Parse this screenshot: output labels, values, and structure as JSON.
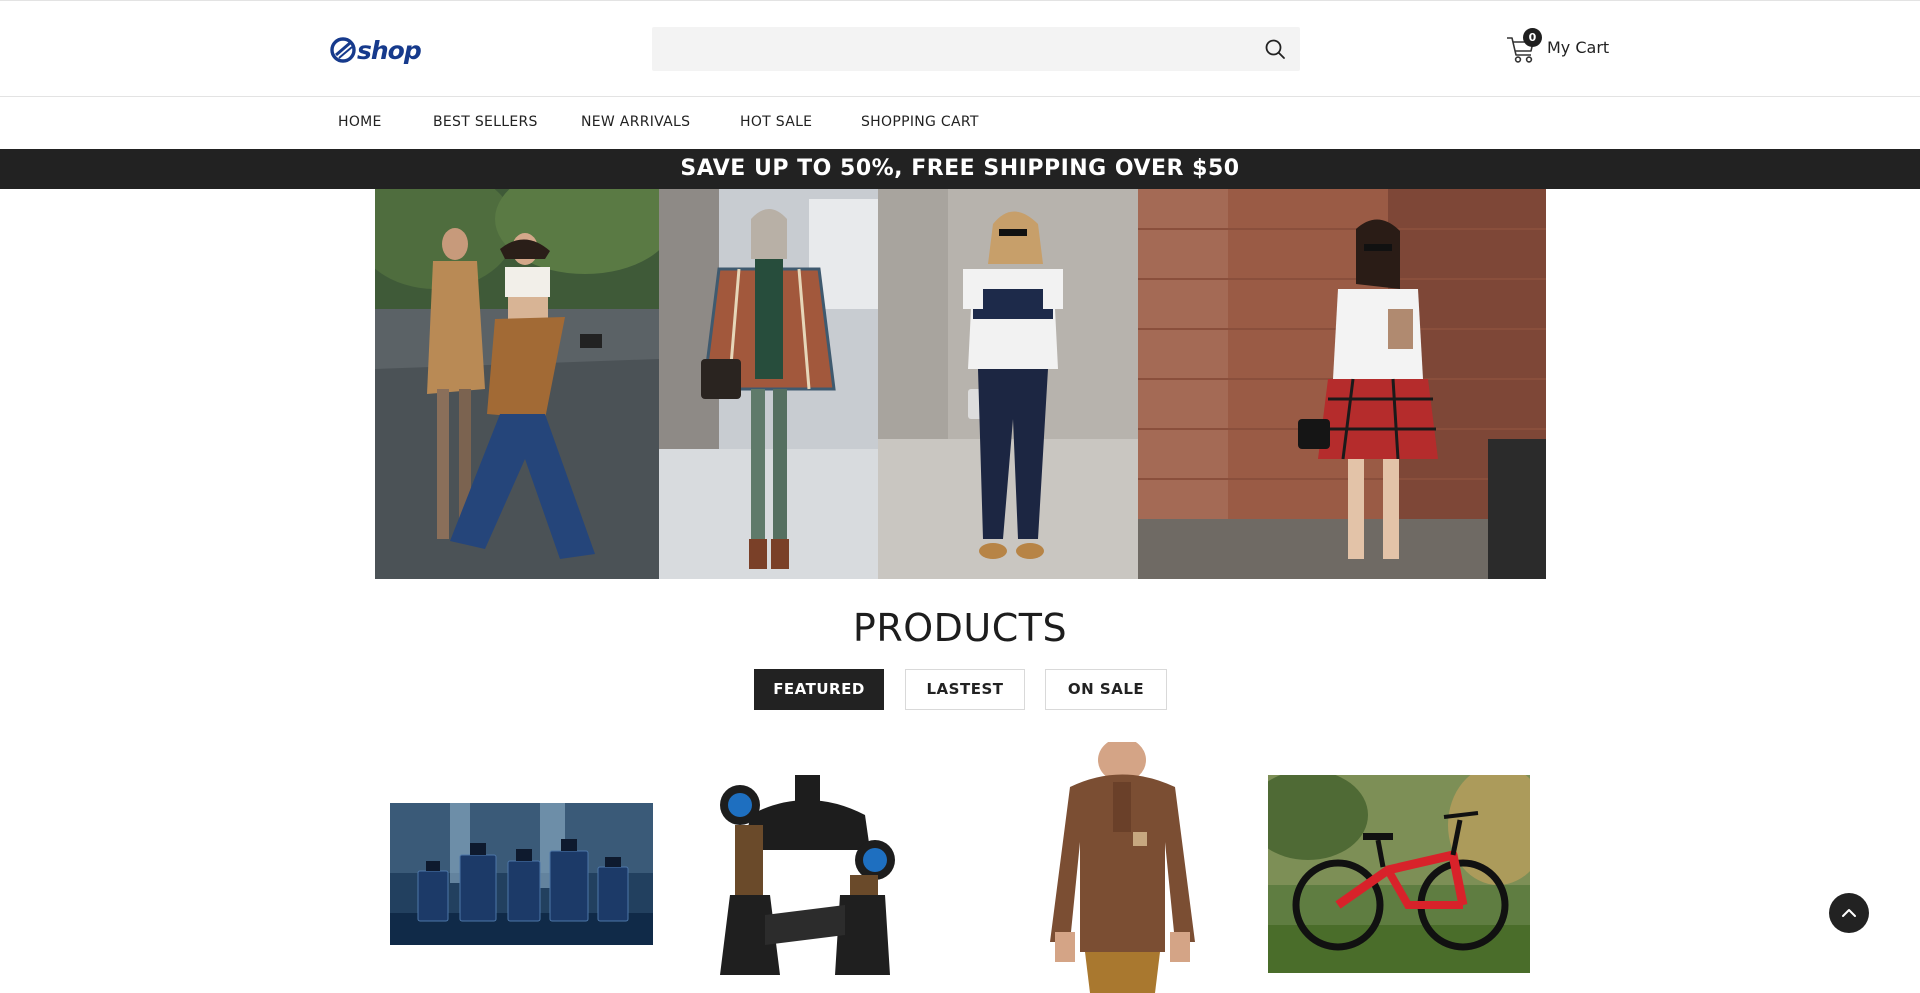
{
  "header": {
    "logo_text": "shop",
    "search_placeholder": "",
    "cart_count": "0",
    "cart_label": "My Cart"
  },
  "nav": {
    "items": [
      {
        "label": "HOME"
      },
      {
        "label": "BEST SELLERS"
      },
      {
        "label": "NEW ARRIVALS"
      },
      {
        "label": "HOT SALE"
      },
      {
        "label": "SHOPPING CART"
      }
    ]
  },
  "promo": {
    "text": "SAVE UP TO 50%, FREE SHIPPING OVER $50"
  },
  "products_section": {
    "title": "PRODUCTS",
    "tabs": [
      {
        "label": "FEATURED",
        "active": true
      },
      {
        "label": "LASTEST",
        "active": false
      },
      {
        "label": "ON SALE",
        "active": false
      }
    ]
  },
  "products": [
    {
      "image": "perfume-bottles"
    },
    {
      "image": "bike-suspension-fork"
    },
    {
      "image": "brown-pullover-sweater"
    },
    {
      "image": "red-mountain-bike"
    }
  ],
  "colors": {
    "logo_blue": "#163a8c",
    "dark": "#222222",
    "search_bg": "#f3f3f3"
  }
}
